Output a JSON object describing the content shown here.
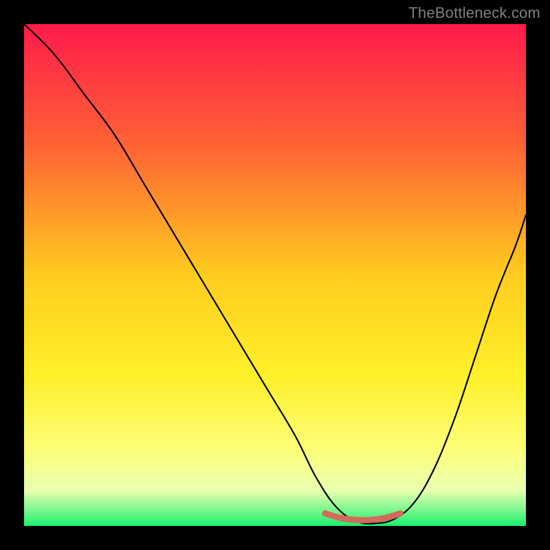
{
  "watermark": "TheBottleneck.com",
  "chart_data": {
    "type": "line",
    "title": "",
    "xlabel": "",
    "ylabel": "",
    "xlim": [
      0,
      100
    ],
    "ylim": [
      0,
      100
    ],
    "grid": false,
    "legend": false,
    "background_gradient": {
      "stops": [
        {
          "offset": 0.0,
          "color": "#ff1a4b"
        },
        {
          "offset": 0.25,
          "color": "#ff6634"
        },
        {
          "offset": 0.5,
          "color": "#ffcc1f"
        },
        {
          "offset": 0.7,
          "color": "#fff029"
        },
        {
          "offset": 0.85,
          "color": "#fdff7a"
        },
        {
          "offset": 0.93,
          "color": "#e8ffb0"
        },
        {
          "offset": 1.0,
          "color": "#1cf06e"
        }
      ]
    },
    "series": [
      {
        "name": "curve",
        "color": "#000000",
        "width": 2.2,
        "x": [
          0,
          6,
          12,
          18,
          24,
          30,
          36,
          42,
          48,
          54,
          58,
          62,
          66,
          70,
          74,
          78,
          82,
          86,
          90,
          94,
          98,
          100
        ],
        "y": [
          100,
          94,
          86,
          78,
          68,
          58,
          48,
          38,
          28,
          18,
          10,
          4,
          1,
          0.5,
          1.5,
          5,
          12,
          22,
          34,
          46,
          56,
          62
        ]
      },
      {
        "name": "minimum-band",
        "color": "#d46a5b",
        "width": 9,
        "linecap": "round",
        "x": [
          60,
          63,
          66,
          69,
          72,
          75
        ],
        "y": [
          2.5,
          1.6,
          1.2,
          1.2,
          1.6,
          2.5
        ]
      }
    ]
  }
}
